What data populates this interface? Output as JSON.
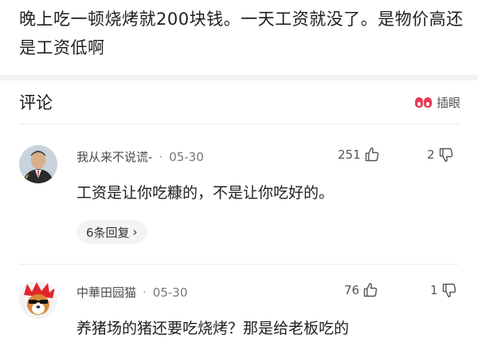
{
  "post": {
    "text": "晚上吃一顿烧烤就200块钱。一天工资就没了。是物价高还是工资低啊"
  },
  "comments_section": {
    "title": "评论",
    "insert_eye_label": "插眼"
  },
  "comments": [
    {
      "username": "我从来不说谎-",
      "date": "05-30",
      "likes": "251",
      "dislikes": "2",
      "text": "工资是让你吃糠的，不是让你吃好的。",
      "replies_label": "6条回复",
      "replies_arrow": "›"
    },
    {
      "username": "中華田园猫",
      "date": "05-30",
      "likes": "76",
      "dislikes": "1",
      "text": "养猪场的猪还要吃烧烤？那是给老板吃的"
    }
  ],
  "separator": "·"
}
